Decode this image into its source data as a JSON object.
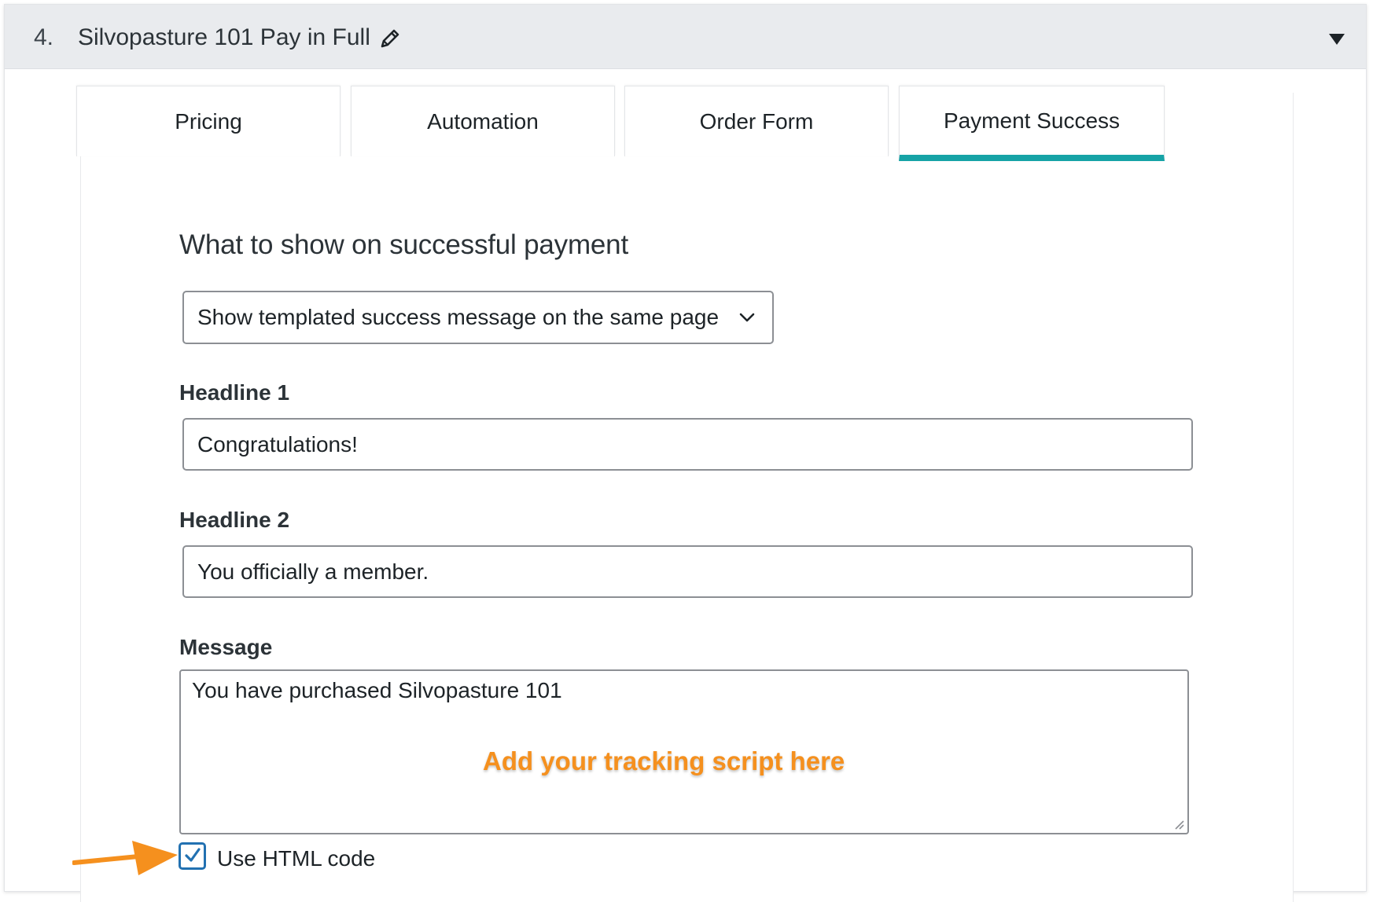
{
  "header": {
    "number": "4.",
    "title": "Silvopasture 101 Pay in Full",
    "edit_icon": "pencil-icon",
    "toggle_icon": "triangle-down-icon"
  },
  "tabs": [
    {
      "label": "Pricing",
      "active": false
    },
    {
      "label": "Automation",
      "active": false
    },
    {
      "label": "Order Form",
      "active": false
    },
    {
      "label": "Payment Success",
      "active": true
    }
  ],
  "colors": {
    "active_tab_underline": "#16a3a6",
    "checkbox_accent": "#2271b1",
    "annotation": "#f5901e"
  },
  "success": {
    "section_title": "What to show on successful payment",
    "select_value": "Show templated success message on the same page",
    "headline1_label": "Headline 1",
    "headline1_value": "Congratulations!",
    "headline2_label": "Headline 2",
    "headline2_value": "You officially a member.",
    "message_label": "Message",
    "message_value": "You have purchased Silvopasture 101",
    "use_html_label": "Use HTML code",
    "use_html_checked": true
  },
  "annotation": {
    "text": "Add your tracking script here",
    "arrow_icon": "orange-arrow-icon"
  }
}
